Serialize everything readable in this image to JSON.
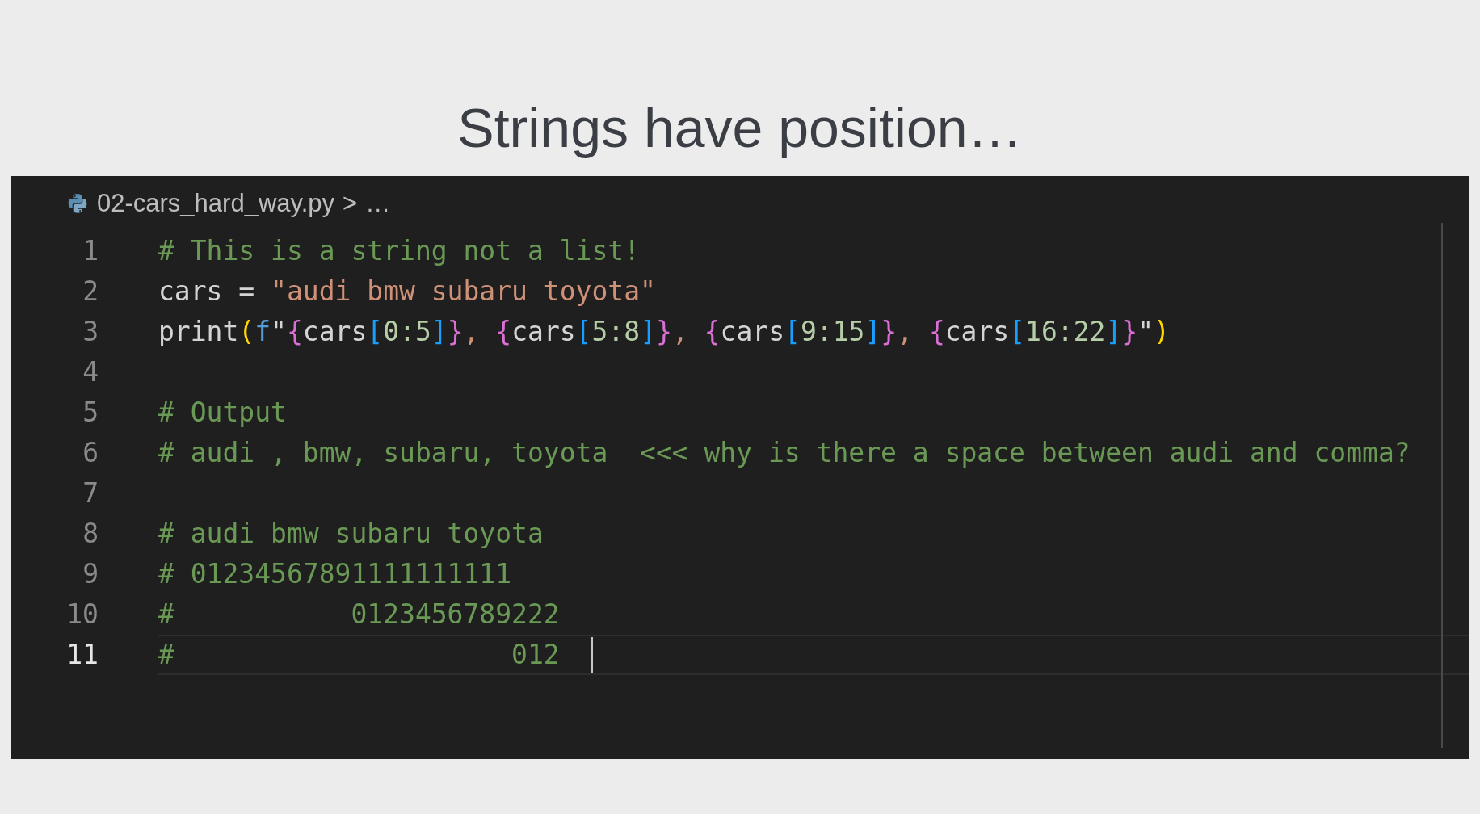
{
  "slide_title": "Strings have position…",
  "editor": {
    "breadcrumb": {
      "file": "02-cars_hard_way.py",
      "separator": ">",
      "ellipsis": "…"
    },
    "lines": [
      {
        "number": "1",
        "current": false,
        "tokens": [
          {
            "kind": "comment",
            "text": "# This is a string not a list!"
          }
        ]
      },
      {
        "number": "2",
        "current": false,
        "tokens": [
          {
            "kind": "plain",
            "text": "cars = "
          },
          {
            "kind": "string",
            "text": "\"audi bmw subaru toyota\""
          }
        ]
      },
      {
        "number": "3",
        "current": false,
        "tokens": [
          {
            "kind": "plain",
            "text": "print"
          },
          {
            "kind": "paren",
            "text": "("
          },
          {
            "kind": "fprefix",
            "text": "f"
          },
          {
            "kind": "plain",
            "text": "\""
          },
          {
            "kind": "brace",
            "text": "{"
          },
          {
            "kind": "plain",
            "text": "cars"
          },
          {
            "kind": "bracket",
            "text": "["
          },
          {
            "kind": "number",
            "text": "0:5"
          },
          {
            "kind": "bracket",
            "text": "]"
          },
          {
            "kind": "brace",
            "text": "}"
          },
          {
            "kind": "string",
            "text": ", "
          },
          {
            "kind": "brace",
            "text": "{"
          },
          {
            "kind": "plain",
            "text": "cars"
          },
          {
            "kind": "bracket",
            "text": "["
          },
          {
            "kind": "number",
            "text": "5:8"
          },
          {
            "kind": "bracket",
            "text": "]"
          },
          {
            "kind": "brace",
            "text": "}"
          },
          {
            "kind": "string",
            "text": ", "
          },
          {
            "kind": "brace",
            "text": "{"
          },
          {
            "kind": "plain",
            "text": "cars"
          },
          {
            "kind": "bracket",
            "text": "["
          },
          {
            "kind": "number",
            "text": "9:15"
          },
          {
            "kind": "bracket",
            "text": "]"
          },
          {
            "kind": "brace",
            "text": "}"
          },
          {
            "kind": "string",
            "text": ", "
          },
          {
            "kind": "brace",
            "text": "{"
          },
          {
            "kind": "plain",
            "text": "cars"
          },
          {
            "kind": "bracket",
            "text": "["
          },
          {
            "kind": "number",
            "text": "16:22"
          },
          {
            "kind": "bracket",
            "text": "]"
          },
          {
            "kind": "brace",
            "text": "}"
          },
          {
            "kind": "plain",
            "text": "\""
          },
          {
            "kind": "paren",
            "text": ")"
          }
        ]
      },
      {
        "number": "4",
        "current": false
      },
      {
        "number": "5",
        "current": false,
        "tokens": [
          {
            "kind": "comment",
            "text": "# Output"
          }
        ]
      },
      {
        "number": "6",
        "current": false,
        "tokens": [
          {
            "kind": "comment",
            "text": "# audi , bmw, subaru, toyota  <<< why is there a space between audi and comma?"
          }
        ]
      },
      {
        "number": "7",
        "current": false
      },
      {
        "number": "8",
        "current": false,
        "tokens": [
          {
            "kind": "comment",
            "text": "# audi bmw subaru toyota"
          }
        ]
      },
      {
        "number": "9",
        "current": false,
        "tokens": [
          {
            "kind": "comment",
            "text": "# 01234567891111111111"
          }
        ]
      },
      {
        "number": "10",
        "current": false,
        "tokens": [
          {
            "kind": "comment",
            "text": "#           0123456789222"
          }
        ]
      },
      {
        "number": "11",
        "current": true,
        "tokens": [
          {
            "kind": "comment",
            "text": "#                     012"
          }
        ]
      }
    ]
  }
}
